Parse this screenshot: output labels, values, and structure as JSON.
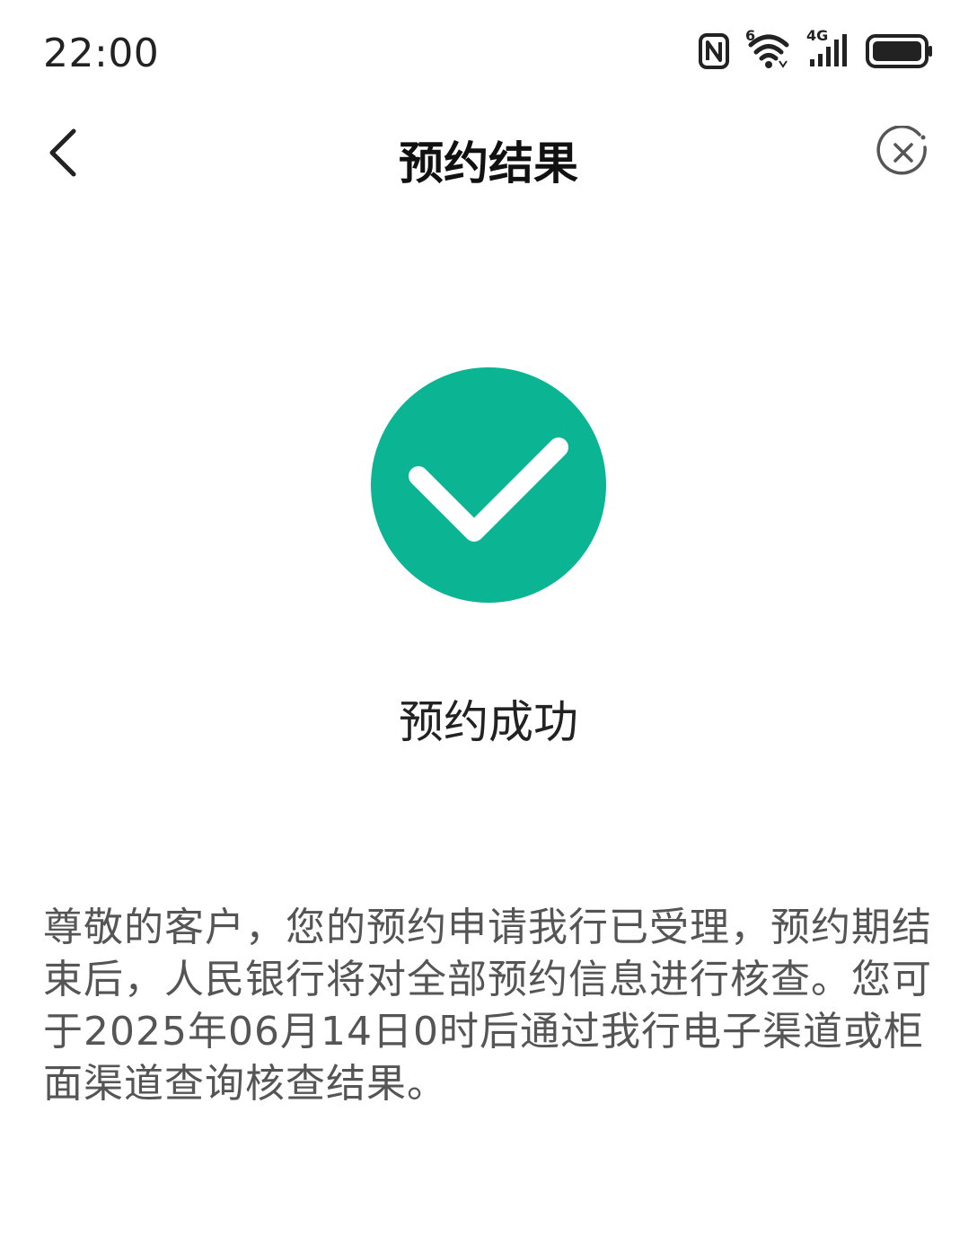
{
  "status_bar": {
    "time": "22:00",
    "wifi_badge": "6",
    "network_badge": "4G"
  },
  "nav": {
    "title": "预约结果",
    "back_icon": "chevron-left-icon",
    "close_icon": "close-circle-icon"
  },
  "result": {
    "icon": "check-circle-icon",
    "icon_color": "#0BB594",
    "title": "预约成功",
    "message": "尊敬的客户，您的预约申请我行已受理，预约期结束后，人民银行将对全部预约信息进行核查。您可于2025年06月14日0时后通过我行电子渠道或柜面渠道查询核查结果。"
  }
}
